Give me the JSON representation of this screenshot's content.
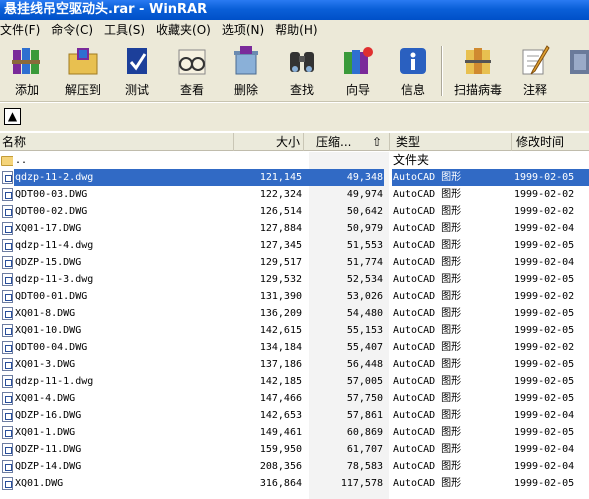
{
  "window": {
    "title": "悬挂线吊空驱动头.rar - WinRAR"
  },
  "menu": [
    "文件(F)",
    "命令(C)",
    "工具(S)",
    "收藏夹(O)",
    "选项(N)",
    "帮助(H)"
  ],
  "toolbar": {
    "add": "添加",
    "extract": "解压到",
    "test": "测试",
    "view": "查看",
    "delete": "删除",
    "find": "查找",
    "wizard": "向导",
    "info": "信息",
    "virus": "扫描病毒",
    "comment": "注释"
  },
  "columns": {
    "name": "名称",
    "size": "大小",
    "packed": "压缩...",
    "type": "类型",
    "modified": "修改时间"
  },
  "parent_row": {
    "name": "..",
    "type": "文件夹"
  },
  "files": [
    {
      "name": "qdzp-11-2.dwg",
      "size": "121,145",
      "packed": "49,348",
      "type": "AutoCAD 图形",
      "date": "1999-02-05",
      "selected": true
    },
    {
      "name": "QDT00-03.DWG",
      "size": "122,324",
      "packed": "49,974",
      "type": "AutoCAD 图形",
      "date": "1999-02-02"
    },
    {
      "name": "QDT00-02.DWG",
      "size": "126,514",
      "packed": "50,642",
      "type": "AutoCAD 图形",
      "date": "1999-02-02"
    },
    {
      "name": "XQ01-17.DWG",
      "size": "127,884",
      "packed": "50,979",
      "type": "AutoCAD 图形",
      "date": "1999-02-04"
    },
    {
      "name": "qdzp-11-4.dwg",
      "size": "127,345",
      "packed": "51,553",
      "type": "AutoCAD 图形",
      "date": "1999-02-05"
    },
    {
      "name": "QDZP-15.DWG",
      "size": "129,517",
      "packed": "51,774",
      "type": "AutoCAD 图形",
      "date": "1999-02-04"
    },
    {
      "name": "qdzp-11-3.dwg",
      "size": "129,532",
      "packed": "52,534",
      "type": "AutoCAD 图形",
      "date": "1999-02-05"
    },
    {
      "name": "QDT00-01.DWG",
      "size": "131,390",
      "packed": "53,026",
      "type": "AutoCAD 图形",
      "date": "1999-02-02"
    },
    {
      "name": "XQ01-8.DWG",
      "size": "136,209",
      "packed": "54,480",
      "type": "AutoCAD 图形",
      "date": "1999-02-05"
    },
    {
      "name": "XQ01-10.DWG",
      "size": "142,615",
      "packed": "55,153",
      "type": "AutoCAD 图形",
      "date": "1999-02-05"
    },
    {
      "name": "QDT00-04.DWG",
      "size": "134,184",
      "packed": "55,407",
      "type": "AutoCAD 图形",
      "date": "1999-02-02"
    },
    {
      "name": "XQ01-3.DWG",
      "size": "137,186",
      "packed": "56,448",
      "type": "AutoCAD 图形",
      "date": "1999-02-05"
    },
    {
      "name": "qdzp-11-1.dwg",
      "size": "142,185",
      "packed": "57,005",
      "type": "AutoCAD 图形",
      "date": "1999-02-05"
    },
    {
      "name": "XQ01-4.DWG",
      "size": "147,466",
      "packed": "57,750",
      "type": "AutoCAD 图形",
      "date": "1999-02-05"
    },
    {
      "name": "QDZP-16.DWG",
      "size": "142,653",
      "packed": "57,861",
      "type": "AutoCAD 图形",
      "date": "1999-02-04"
    },
    {
      "name": "XQ01-1.DWG",
      "size": "149,461",
      "packed": "60,869",
      "type": "AutoCAD 图形",
      "date": "1999-02-05"
    },
    {
      "name": "QDZP-11.DWG",
      "size": "159,950",
      "packed": "61,707",
      "type": "AutoCAD 图形",
      "date": "1999-02-04"
    },
    {
      "name": "QDZP-14.DWG",
      "size": "208,356",
      "packed": "78,583",
      "type": "AutoCAD 图形",
      "date": "1999-02-04"
    },
    {
      "name": "XQ01.DWG",
      "size": "316,864",
      "packed": "117,578",
      "type": "AutoCAD 图形",
      "date": "1999-02-05"
    }
  ],
  "colors": {
    "selection": "#316ac5",
    "titlebar": "#0a5fd8",
    "chrome": "#ece9d8"
  }
}
